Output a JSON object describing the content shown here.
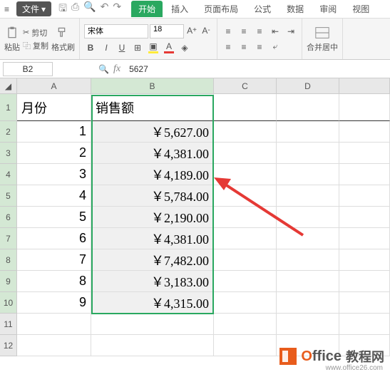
{
  "menubar": {
    "file_label": "文件",
    "tabs": [
      "开始",
      "插入",
      "页面布局",
      "公式",
      "数据",
      "审阅",
      "视图"
    ],
    "active_tab": 0
  },
  "ribbon": {
    "paste_label": "粘贴",
    "cut_label": "剪切",
    "copy_label": "复制",
    "format_brush_label": "格式刷",
    "font_name": "宋体",
    "font_size": "18",
    "merge_label": "合并居中"
  },
  "namebox": {
    "ref": "B2",
    "formula_value": "5627"
  },
  "sheet": {
    "col_headers": [
      "A",
      "B",
      "C",
      "D"
    ],
    "row_headers": [
      "1",
      "2",
      "3",
      "4",
      "5",
      "6",
      "7",
      "8",
      "9",
      "10",
      "11",
      "12"
    ],
    "header_row": {
      "A": "月份",
      "B": "销售额"
    },
    "rows": [
      {
        "A": "1",
        "B": "￥5,627.00"
      },
      {
        "A": "2",
        "B": "￥4,381.00"
      },
      {
        "A": "3",
        "B": "￥4,189.00"
      },
      {
        "A": "4",
        "B": "￥5,784.00"
      },
      {
        "A": "5",
        "B": "￥2,190.00"
      },
      {
        "A": "6",
        "B": "￥4,381.00"
      },
      {
        "A": "7",
        "B": "￥7,482.00"
      },
      {
        "A": "8",
        "B": "￥3,183.00"
      },
      {
        "A": "9",
        "B": "￥4,315.00"
      }
    ]
  },
  "chart_data": {
    "type": "table",
    "title": "销售额",
    "categories": [
      1,
      2,
      3,
      4,
      5,
      6,
      7,
      8,
      9
    ],
    "values": [
      5627,
      4381,
      4189,
      5784,
      2190,
      4381,
      7482,
      3183,
      4315
    ],
    "xlabel": "月份",
    "ylabel": "销售额 (￥)",
    "currency": "CNY"
  },
  "watermark": {
    "brand_o": "O",
    "brand_rest": "ffice",
    "brand_cn": "教程网",
    "url": "www.office26.com"
  }
}
